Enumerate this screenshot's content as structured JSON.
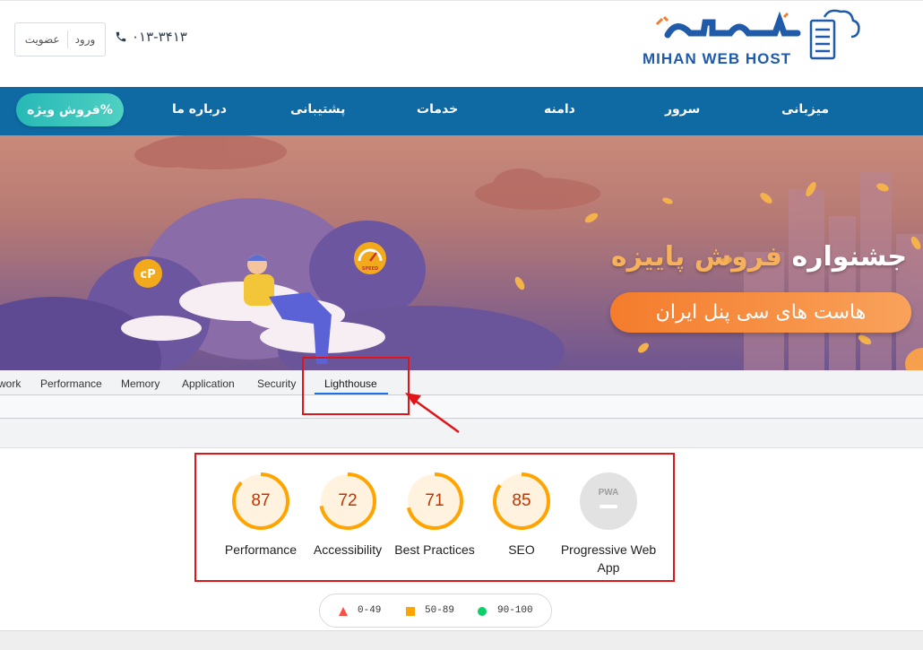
{
  "header": {
    "login_label": "ورود",
    "signup_label": "عضویت",
    "phone": "۰۱۳-۳۴۱۳",
    "logo_fa": "میهن وب هاست",
    "logo_en": "MIHAN WEB HOST"
  },
  "nav": {
    "items": [
      "میزبانی",
      "سرور",
      "دامنه",
      "خدمات",
      "پشتیبانی",
      "درباره ما"
    ],
    "special_label": "فروش ویژه%"
  },
  "banner": {
    "title_part1": "جشنواره",
    "title_part2": "فروش پاییزه",
    "subtitle": "هاست های سی پنل ایران",
    "cpanel_badge": "cP",
    "speed_badge": "SPEED"
  },
  "devtools": {
    "tabs": [
      "work",
      "Performance",
      "Memory",
      "Application",
      "Security",
      "Lighthouse"
    ],
    "active_tab": "Lighthouse"
  },
  "lighthouse": {
    "scores": [
      {
        "label": "Performance",
        "value": 87
      },
      {
        "label": "Accessibility",
        "value": 72
      },
      {
        "label": "Best Practices",
        "value": 71
      },
      {
        "label": "SEO",
        "value": 85
      }
    ],
    "pwa": {
      "label": "Progressive Web App",
      "badge": "PWA"
    },
    "legend": [
      {
        "range": "0-49",
        "color": "#ff4e42",
        "shape": "triangle"
      },
      {
        "range": "50-89",
        "color": "#ffa400",
        "shape": "square"
      },
      {
        "range": "90-100",
        "color": "#0cce6b",
        "shape": "circle"
      }
    ],
    "score_color": "#ffa400",
    "score_text_color": "#c33300"
  },
  "annotation_color": "#e0151a"
}
